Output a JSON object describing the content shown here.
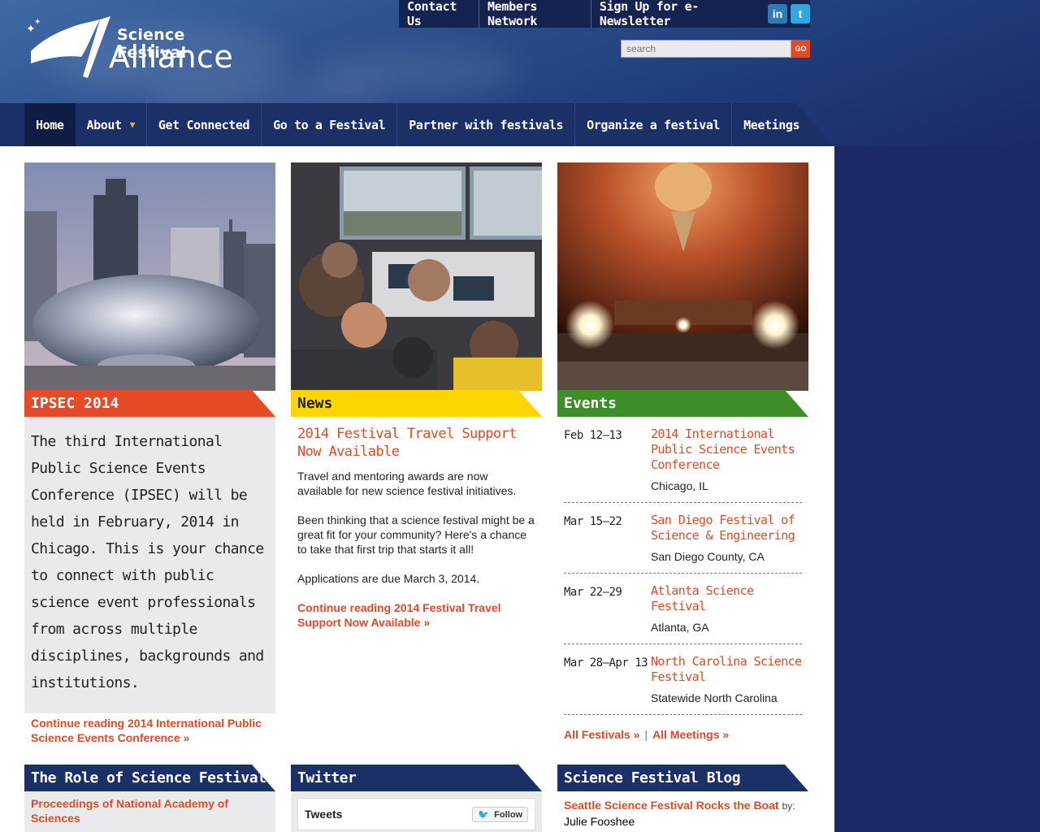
{
  "header": {
    "logo_line1": "Science Festival",
    "logo_line2": "Alliance",
    "top_links": [
      "Contact Us",
      "Members Network",
      "Sign Up for e-Newsletter"
    ],
    "social": [
      {
        "icon": "linkedin-icon",
        "glyph": "in"
      },
      {
        "icon": "twitter-icon",
        "glyph": "t"
      }
    ],
    "search_placeholder": "search",
    "search_button": "GO"
  },
  "nav": {
    "home": "Home",
    "about": "About",
    "get_connected": "Get Connected",
    "go_festival": "Go to a Festival",
    "partner": "Partner with festivals",
    "organize": "Organize a festival",
    "meetings": "Meetings"
  },
  "ipsec": {
    "banner": "IPSEC 2014",
    "body": "The third International Public Science Events Conference (IPSEC) will be held in February, 2014 in Chicago. This is your chance to connect with public science event professionals from across multiple disciplines, backgrounds and institutions.",
    "link": "Continue reading 2014 International Public Science Events Conference »"
  },
  "news": {
    "banner": "News",
    "title": "2014 Festival Travel Support Now Available",
    "p1": "Travel and mentoring awards are now available for new science festival initiatives.",
    "p2": "Been thinking that a science festival might be a great fit for your community? Here's a chance to take that first trip that starts it all!",
    "p3": "Applications are due March 3, 2014.",
    "link": "Continue reading 2014 Festival Travel Support Now Available »"
  },
  "events": {
    "banner": "Events",
    "items": [
      {
        "date": "Feb 12–13",
        "name": "2014 International Public Science Events Conference",
        "location": "Chicago, IL"
      },
      {
        "date": "Mar 15–22",
        "name": "San Diego Festival of Science & Engineering",
        "location": "San Diego County, CA"
      },
      {
        "date": "Mar 22–29",
        "name": "Atlanta Science Festival",
        "location": "Atlanta, GA"
      },
      {
        "date": "Mar 28–Apr 13",
        "name": "North Carolina Science Festival",
        "location": "Statewide North Carolina"
      }
    ],
    "all_festivals": "All Festivals »",
    "separator": "|",
    "all_meetings": "All Meetings »"
  },
  "bottom": {
    "role_title": "The Role of Science Festivals",
    "role_link": "Proceedings of National Academy of Sciences",
    "twitter_title": "Twitter",
    "tweets_label": "Tweets",
    "follow_label": "Follow",
    "blog_title": "Science Festival Blog",
    "blog_link": "Seattle Science Festival Rocks the Boat",
    "blog_by": "by:",
    "blog_author": "Julie Fooshee"
  },
  "colors": {
    "accent_orange": "#e04a28",
    "news_yellow": "#fdd500",
    "events_green": "#3e8e2a",
    "navy": "#1c3068"
  }
}
